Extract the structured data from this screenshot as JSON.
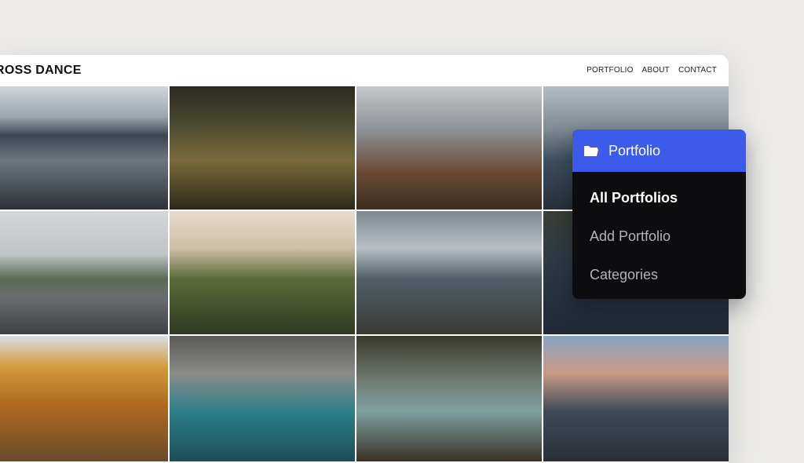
{
  "site": {
    "logo": "ROSS DANCE",
    "nav": [
      "PORTFOLIO",
      "ABOUT",
      "CONTACT"
    ]
  },
  "gallery": {
    "photos": [
      "couple-mountain-lake",
      "couple-forest-embrace",
      "couple-city-rooftop",
      "mountain-lake-forest",
      "couple-snowy-road",
      "couple-field-laughing",
      "couple-winter-dock",
      "couple-closeup-partial",
      "couple-autumn-trees",
      "couple-river-rocks",
      "couple-waterfall-canyon",
      "couple-camper-van-mountains"
    ]
  },
  "menu": {
    "title": "Portfolio",
    "icon": "folder-open-icon",
    "items": [
      {
        "label": "All Portfolios",
        "active": true
      },
      {
        "label": "Add Portfolio",
        "active": false
      },
      {
        "label": "Categories",
        "active": false
      }
    ],
    "accent": "#3d5bea",
    "background": "#0d0d0f"
  }
}
